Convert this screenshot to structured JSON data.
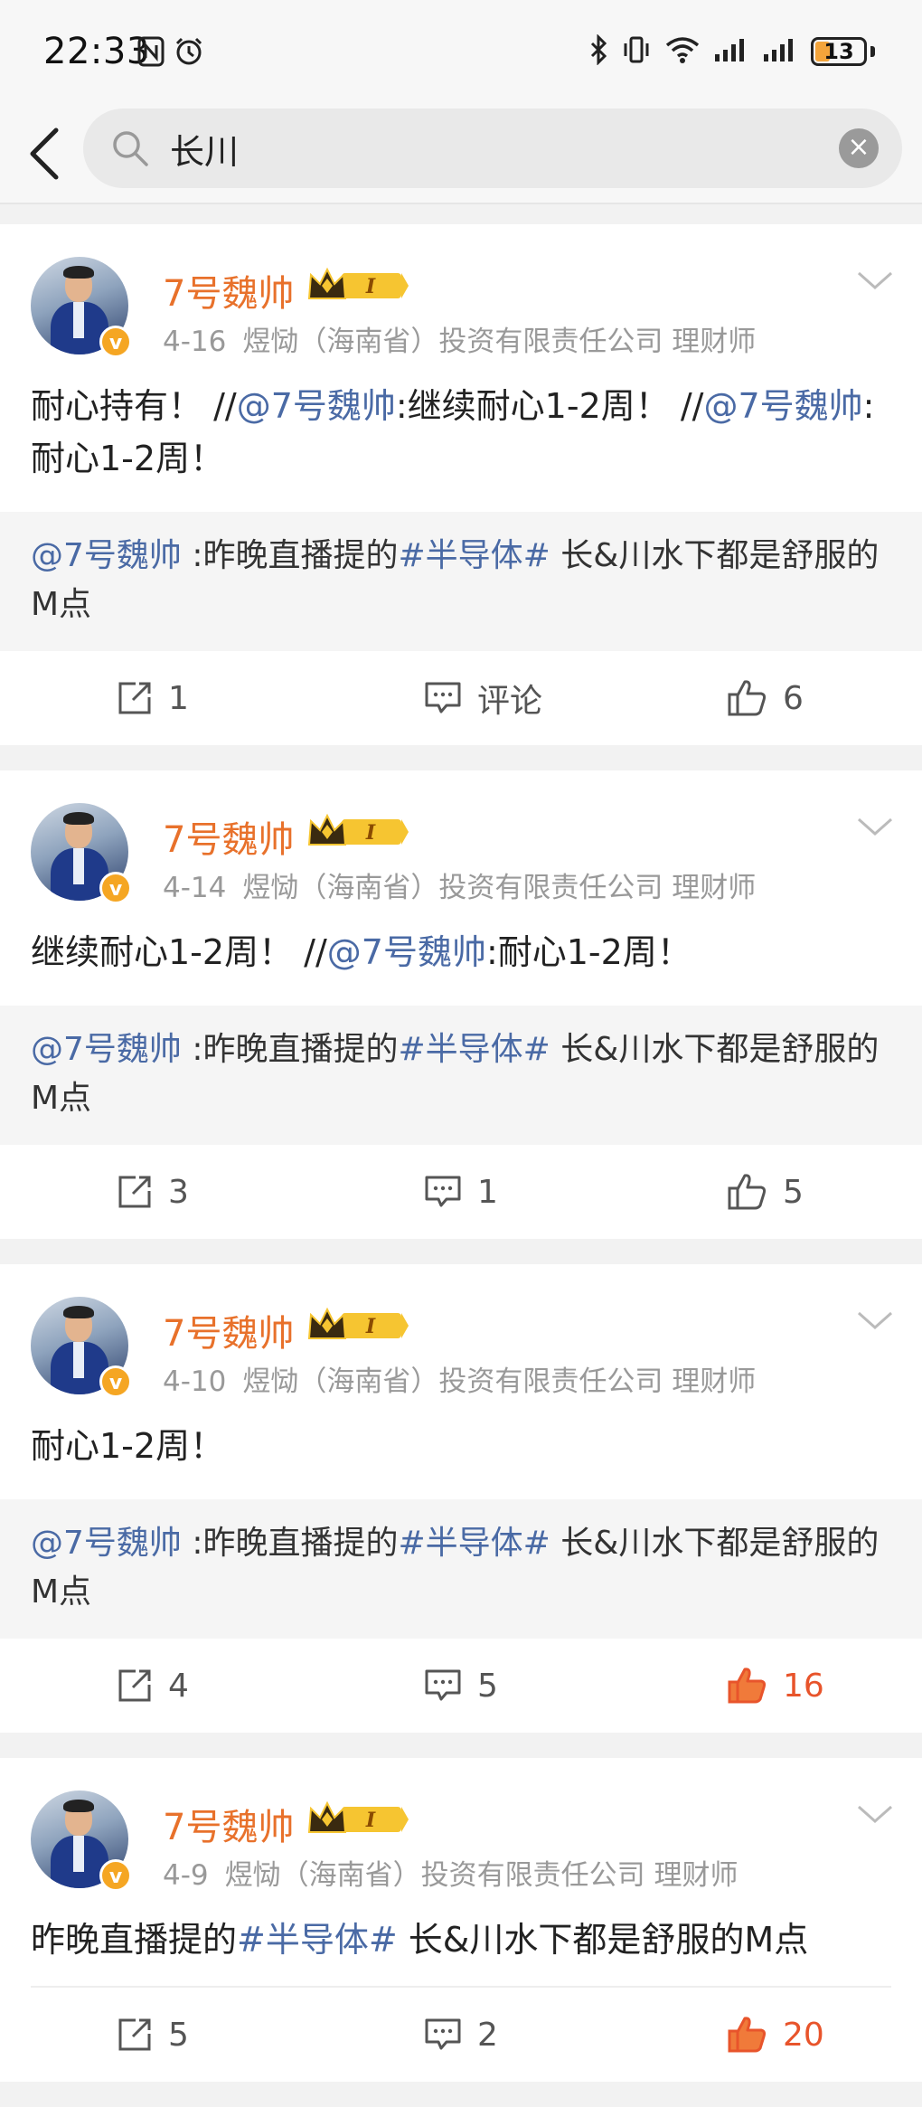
{
  "status_bar": {
    "time": "22:33",
    "battery": "13"
  },
  "search": {
    "query": "长川"
  },
  "posts": [
    {
      "author": "7号魏帅",
      "date": "4-16",
      "source": "煜恸（海南省）投资有限责任公司 理财师",
      "text_parts": [
        {
          "t": "耐心持有！ //",
          "link": false
        },
        {
          "t": "@7号魏帅",
          "link": true
        },
        {
          "t": ":继续耐心1-2周！ //",
          "link": false
        },
        {
          "t": "@7号魏帅",
          "link": true
        },
        {
          "t": ":耐心1-2周！",
          "link": false
        }
      ],
      "repost_parts": [
        {
          "t": "@7号魏帅",
          "link": true
        },
        {
          "t": " :昨晚直播提的",
          "link": false
        },
        {
          "t": "#半导体#",
          "link": true
        },
        {
          "t": " 长&川水下都是舒服的M点",
          "link": false
        }
      ],
      "reposts": "1",
      "comments": "评论",
      "likes": "6",
      "liked": false
    },
    {
      "author": "7号魏帅",
      "date": "4-14",
      "source": "煜恸（海南省）投资有限责任公司 理财师",
      "text_parts": [
        {
          "t": "继续耐心1-2周！ //",
          "link": false
        },
        {
          "t": "@7号魏帅",
          "link": true
        },
        {
          "t": ":耐心1-2周！",
          "link": false
        }
      ],
      "repost_parts": [
        {
          "t": "@7号魏帅",
          "link": true
        },
        {
          "t": " :昨晚直播提的",
          "link": false
        },
        {
          "t": "#半导体#",
          "link": true
        },
        {
          "t": " 长&川水下都是舒服的M点",
          "link": false
        }
      ],
      "reposts": "3",
      "comments": "1",
      "likes": "5",
      "liked": false
    },
    {
      "author": "7号魏帅",
      "date": "4-10",
      "source": "煜恸（海南省）投资有限责任公司 理财师",
      "text_parts": [
        {
          "t": "耐心1-2周！",
          "link": false
        }
      ],
      "repost_parts": [
        {
          "t": "@7号魏帅",
          "link": true
        },
        {
          "t": " :昨晚直播提的",
          "link": false
        },
        {
          "t": "#半导体#",
          "link": true
        },
        {
          "t": " 长&川水下都是舒服的M点",
          "link": false
        }
      ],
      "reposts": "4",
      "comments": "5",
      "likes": "16",
      "liked": true
    },
    {
      "author": "7号魏帅",
      "date": "4-9",
      "source": "煜恸（海南省）投资有限责任公司 理财师",
      "text_parts": [
        {
          "t": "昨晚直播提的",
          "link": false
        },
        {
          "t": "#半导体#",
          "link": true
        },
        {
          "t": " 长&川水下都是舒服的M点",
          "link": false
        }
      ],
      "repost_parts": [],
      "reposts": "5",
      "comments": "2",
      "likes": "20",
      "liked": true
    }
  ],
  "colors": {
    "username": "#e8712b",
    "link": "#4a6aa5",
    "liked": "#e8542b"
  }
}
